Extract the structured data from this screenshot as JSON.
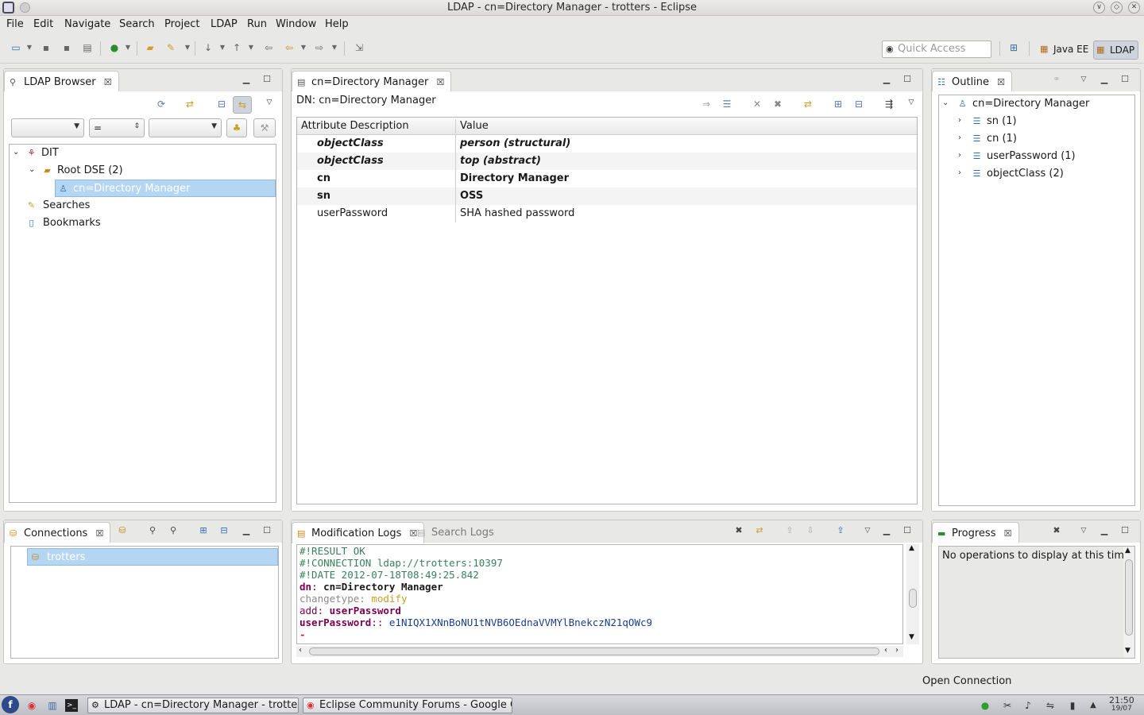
{
  "window": {
    "title": "LDAP - cn=Directory Manager - trotters - Eclipse",
    "controls": [
      "∨",
      "◇",
      "✕"
    ]
  },
  "menu": [
    "File",
    "Edit",
    "Navigate",
    "Search",
    "Project",
    "LDAP",
    "Run",
    "Window",
    "Help"
  ],
  "toolbar": {
    "quick_access_placeholder": "Quick Access",
    "perspectives": [
      "Java EE",
      "LDAP"
    ]
  },
  "ldap_browser": {
    "tab_label": "LDAP Browser",
    "filter_operator": "=",
    "tree": {
      "dit": "DIT",
      "root_dse": "Root DSE (2)",
      "selected_entry": "cn=Directory Manager",
      "searches": "Searches",
      "bookmarks": "Bookmarks"
    }
  },
  "editor": {
    "tab_label": "cn=Directory Manager",
    "dn_label": "DN: cn=Directory Manager",
    "columns": [
      "Attribute Description",
      "Value"
    ],
    "rows": [
      {
        "attr": "objectClass",
        "value": "person (structural)"
      },
      {
        "attr": "objectClass",
        "value": "top (abstract)"
      },
      {
        "attr": "cn",
        "value": "Directory Manager"
      },
      {
        "attr": "sn",
        "value": "OSS"
      },
      {
        "attr": "userPassword",
        "value": "SHA hashed password"
      }
    ]
  },
  "outline": {
    "tab_label": "Outline",
    "root": "cn=Directory Manager",
    "items": [
      "sn (1)",
      "cn (1)",
      "userPassword (1)",
      "objectClass (2)"
    ]
  },
  "connections": {
    "tab_label": "Connections",
    "items": [
      "trotters"
    ]
  },
  "logs": {
    "tab_modification": "Modification Logs",
    "tab_search": "Search Logs",
    "lines": {
      "result": "#!RESULT OK",
      "connection": "#!CONNECTION ldap://trotters:10397",
      "date": "#!DATE 2012-07-18T08:49:25.842",
      "dn_key": "dn",
      "dn_sep": ": ",
      "dn_val": "cn=Directory Manager",
      "ct_key": "changetype",
      "ct_sep": ": ",
      "ct_val": "modify",
      "add_key": "add",
      "add_sep": ": ",
      "add_val": "userPassword",
      "up_key": "userPassword",
      "up_sep": ":: ",
      "up_val": "e1NIQX1XNnBoNU1tNVB6OEdnaVVMYlBnekczN21qOWc9",
      "end": "-"
    }
  },
  "progress": {
    "tab_label": "Progress",
    "message": "No operations to display at this time"
  },
  "status": {
    "text": "Open Connection"
  },
  "taskbar": {
    "tasks": [
      "LDAP - cn=Directory Manager - trotters",
      "Eclipse Community Forums - Google C"
    ],
    "clock_time": "21:50",
    "clock_date": "19/07"
  }
}
